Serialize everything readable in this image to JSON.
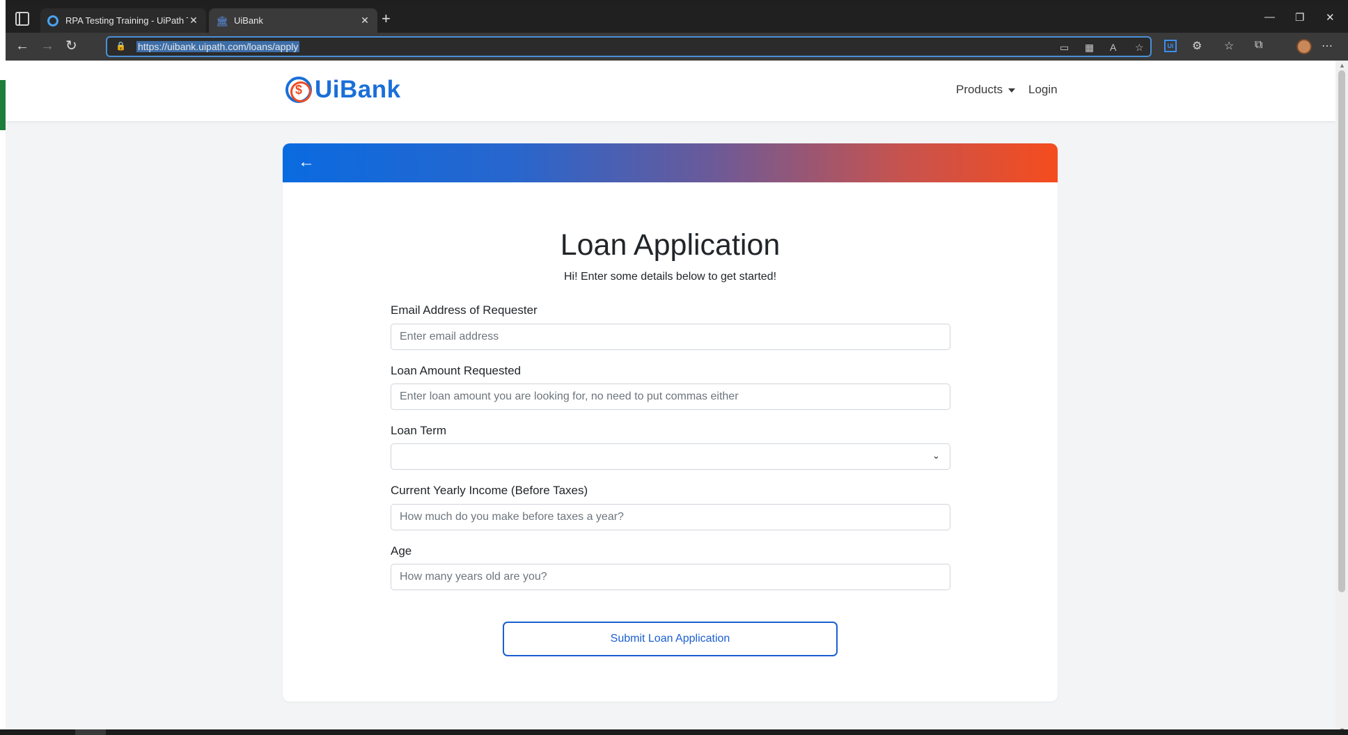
{
  "browser": {
    "tabs": [
      {
        "title": "RPA Testing Training - UiPath Te"
      },
      {
        "title": "UiBank"
      }
    ],
    "url": "https://uibank.uipath.com/loans/apply"
  },
  "site": {
    "logo_symbol": "$",
    "logo_text": "UiBank",
    "nav": {
      "products": "Products",
      "login": "Login"
    }
  },
  "form": {
    "title": "Loan Application",
    "subtitle": "Hi! Enter some details below to get started!",
    "fields": [
      {
        "label": "Email Address of Requester",
        "placeholder": "Enter email address",
        "value": ""
      },
      {
        "label": "Loan Amount Requested",
        "placeholder": "Enter loan amount you are looking for, no need to put commas either",
        "value": ""
      },
      {
        "label": "Loan Term",
        "selected": ""
      },
      {
        "label": "Current Yearly Income (Before Taxes)",
        "placeholder": "How much do you make before taxes a year?",
        "value": ""
      },
      {
        "label": "Age",
        "placeholder": "How many years old are you?",
        "value": ""
      }
    ],
    "submit_label": "Submit Loan Application"
  },
  "colors": {
    "brand_blue": "#1a6fd8",
    "brand_orange": "#f04b23"
  }
}
